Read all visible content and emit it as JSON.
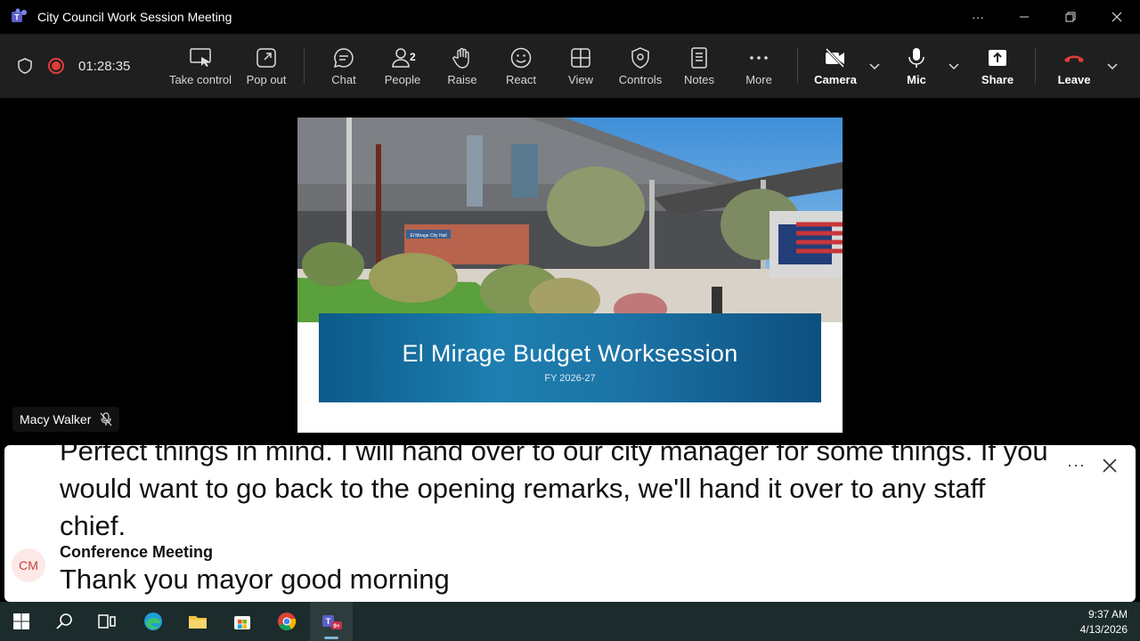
{
  "window": {
    "title": "City Council Work Session Meeting",
    "controls": {
      "more": "···"
    }
  },
  "toolbar": {
    "timer": "01:28:35",
    "buttons": [
      {
        "label": "Take control",
        "icon": "take-control-icon"
      },
      {
        "label": "Pop out",
        "icon": "pop-out-icon"
      },
      {
        "label": "Chat",
        "icon": "chat-icon"
      },
      {
        "label": "People",
        "icon": "people-icon",
        "count": "2"
      },
      {
        "label": "Raise",
        "icon": "raise-hand-icon"
      },
      {
        "label": "React",
        "icon": "react-icon"
      },
      {
        "label": "View",
        "icon": "view-icon"
      },
      {
        "label": "Controls",
        "icon": "controls-icon"
      },
      {
        "label": "Notes",
        "icon": "notes-icon"
      },
      {
        "label": "More",
        "icon": "more-icon"
      },
      {
        "label": "Camera",
        "icon": "camera-off-icon"
      },
      {
        "label": "Mic",
        "icon": "mic-icon"
      },
      {
        "label": "Share",
        "icon": "share-icon"
      },
      {
        "label": "Leave",
        "icon": "leave-icon"
      }
    ]
  },
  "stage": {
    "slide": {
      "title": "El Mirage Budget Worksession",
      "subtitle": "FY 2026-27",
      "building_sign": "El Mirage City Hall"
    },
    "presenter": {
      "name": "Macy Walker",
      "muted": true
    }
  },
  "captions": {
    "text": "Perfect things in mind. I will hand over to our city manager for some things. If you would want to go back to the opening remarks, we'll hand it over to any staff chief.",
    "more": "···",
    "speaker": {
      "initials": "CM",
      "name": "Conference Meeting"
    },
    "latest": "Thank you mayor good morning"
  },
  "taskbar": {
    "teams_badge": "9+",
    "time": "9:37 AM",
    "date": "4/13/2026"
  },
  "colors": {
    "toolbar_bg": "#1f1f1f",
    "leave_red": "#e03c3c",
    "record_red": "#e03c3c",
    "banner_blue": "#1d7fb0",
    "taskbar_bg": "#1c2b2b"
  }
}
